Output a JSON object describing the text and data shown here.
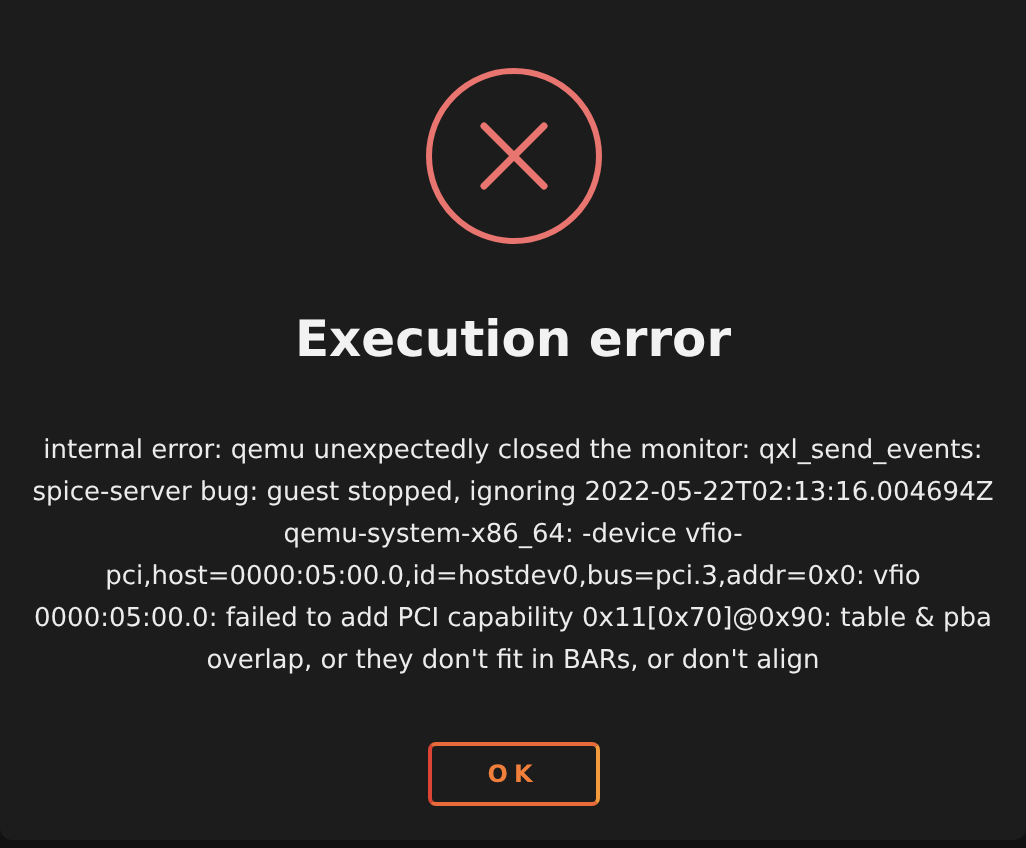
{
  "dialog": {
    "title": "Execution error",
    "message": "internal error: qemu unexpectedly closed the monitor: qxl_send_events: spice-server bug: guest stopped, ignoring 2022-05-22T02:13:16.004694Z qemu-system-x86_64: -device vfio-pci,host=0000:05:00.0,id=hostdev0,bus=pci.3,addr=0x0: vfio 0000:05:00.0: failed to add PCI capability 0x11[0x70]@0x90: table & pba overlap, or they don't fit in BARs, or don't align",
    "buttons": [
      "OK"
    ]
  }
}
